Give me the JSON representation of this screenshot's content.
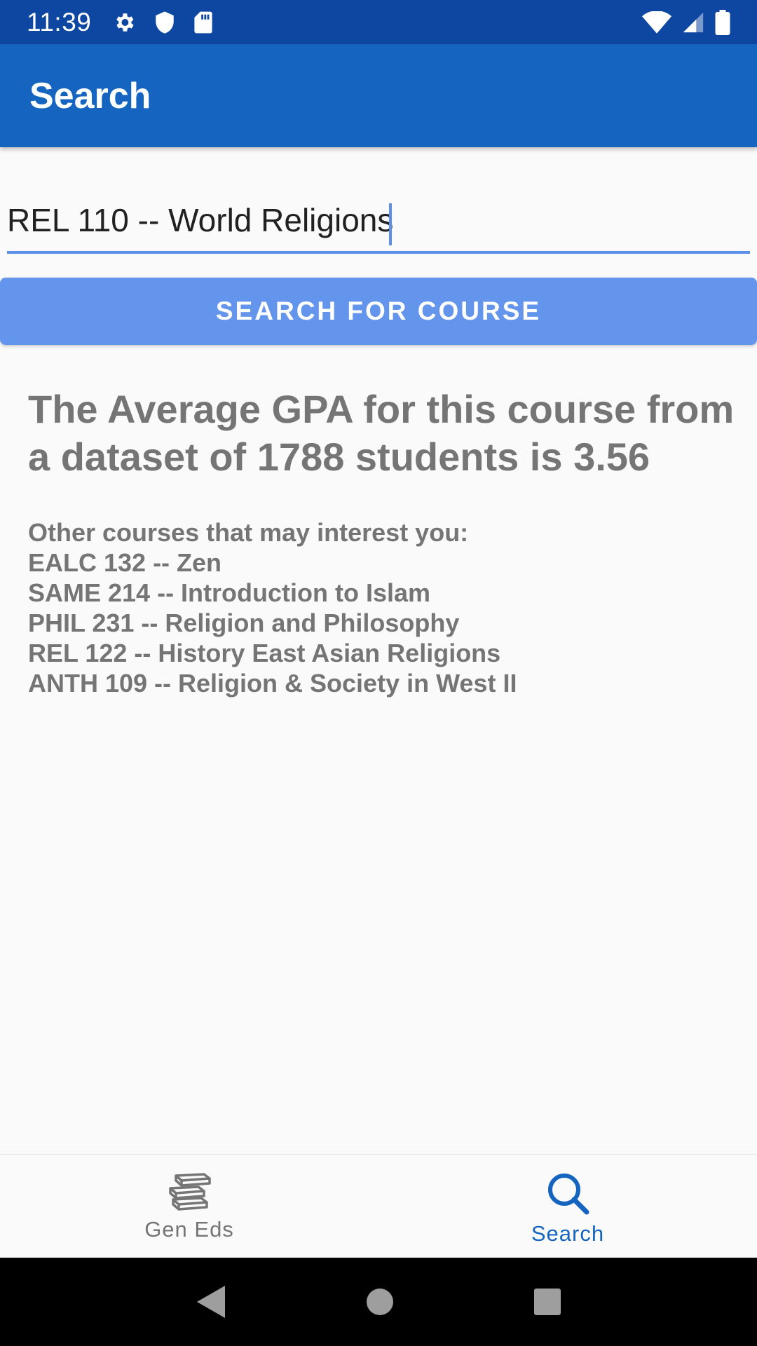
{
  "status_bar": {
    "time": "11:39",
    "icons_left": [
      "settings-icon",
      "shield-icon",
      "sd-card-icon"
    ],
    "icons_right": [
      "wifi-icon",
      "cell-signal-icon",
      "battery-icon"
    ]
  },
  "app_bar": {
    "title": "Search"
  },
  "search": {
    "value": "REL 110 -- World Religions",
    "button_label": "SEARCH FOR COURSE"
  },
  "result": {
    "gpa_text": "The Average GPA for this course from a dataset of 1788 students is 3.56",
    "suggestions_header": "Other courses that may interest you:",
    "suggestions": [
      "EALC 132 -- Zen",
      "SAME 214 -- Introduction to Islam",
      "PHIL 231 -- Religion and Philosophy",
      "REL 122 -- History East Asian Religions",
      "ANTH 109 -- Religion & Society in West II"
    ]
  },
  "bottom_nav": {
    "items": [
      {
        "label": "Gen Eds",
        "icon": "books-icon",
        "active": false
      },
      {
        "label": "Search",
        "icon": "search-icon",
        "active": true
      }
    ]
  },
  "colors": {
    "status_bar": "#0d47a1",
    "app_bar": "#1565c0",
    "button": "#6495ed",
    "accent": "#5c8fe8",
    "result_text": "#757575"
  },
  "system_nav": [
    "back-icon",
    "home-icon",
    "recents-icon"
  ]
}
